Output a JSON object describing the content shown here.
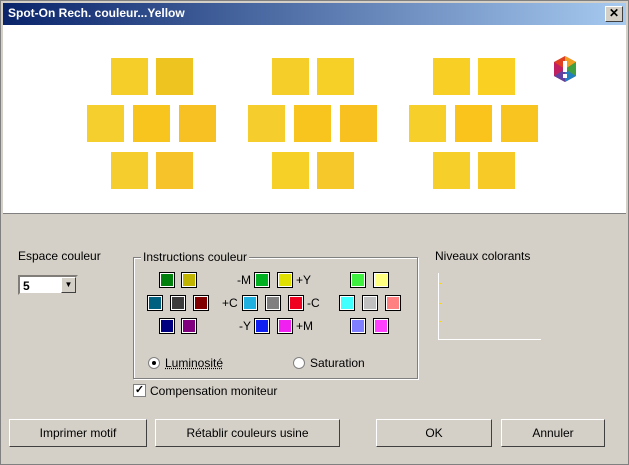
{
  "window": {
    "title": "Spot-On Rech. couleur...Yellow",
    "close_glyph": "✕"
  },
  "preview": {
    "groups": [
      {
        "swatches": [
          "#f5ce2a",
          "#eec421",
          "#f5cf2d",
          "#f7c51d",
          "#f7c124",
          "#f5cd2c",
          "#f7c32b"
        ]
      },
      {
        "swatches": [
          "#f5ce2a",
          "#f7d027",
          "#f5cd2c",
          "#f7c51d",
          "#f8c11f",
          "#f7d027",
          "#f7c82a"
        ]
      },
      {
        "swatches": [
          "#f8d025",
          "#fad022",
          "#f6cf2b",
          "#fac41d",
          "#f8c520",
          "#f6cf2b",
          "#f8ca28"
        ]
      }
    ],
    "warning_icon": "gamut-warning-icon"
  },
  "color_space": {
    "label": "Espace couleur",
    "value": "5"
  },
  "instructions": {
    "title": "Instructions couleur",
    "left_grid": [
      "#00800c",
      "#c0b400",
      "#006080",
      "#3c3c3c",
      "#800000",
      "#000080",
      "#800080"
    ],
    "center": {
      "top": [
        "#00b020",
        "#e0e000"
      ],
      "mid": [
        "#20b0e0",
        "#808080",
        "#f00020"
      ],
      "bot": [
        "#1020f0",
        "#f020f0"
      ],
      "labels": {
        "m": "-M",
        "y": "+Y",
        "c_plus": "+C",
        "c_minus": "-C",
        "y_minus": "-Y",
        "m_plus": "+M"
      }
    },
    "right_grid": [
      "#40f040",
      "#ffff80",
      "#40ffff",
      "#c0c0c0",
      "#ff8080",
      "#8080ff",
      "#ff40ff"
    ],
    "luminosite": "Luminosité",
    "saturation": "Saturation"
  },
  "compensation": {
    "label": "Compensation moniteur",
    "checked": true
  },
  "levels": {
    "title": "Niveaux colorants"
  },
  "buttons": {
    "print": "Imprimer motif",
    "reset": "Rétablir couleurs usine",
    "ok": "OK",
    "cancel": "Annuler"
  }
}
